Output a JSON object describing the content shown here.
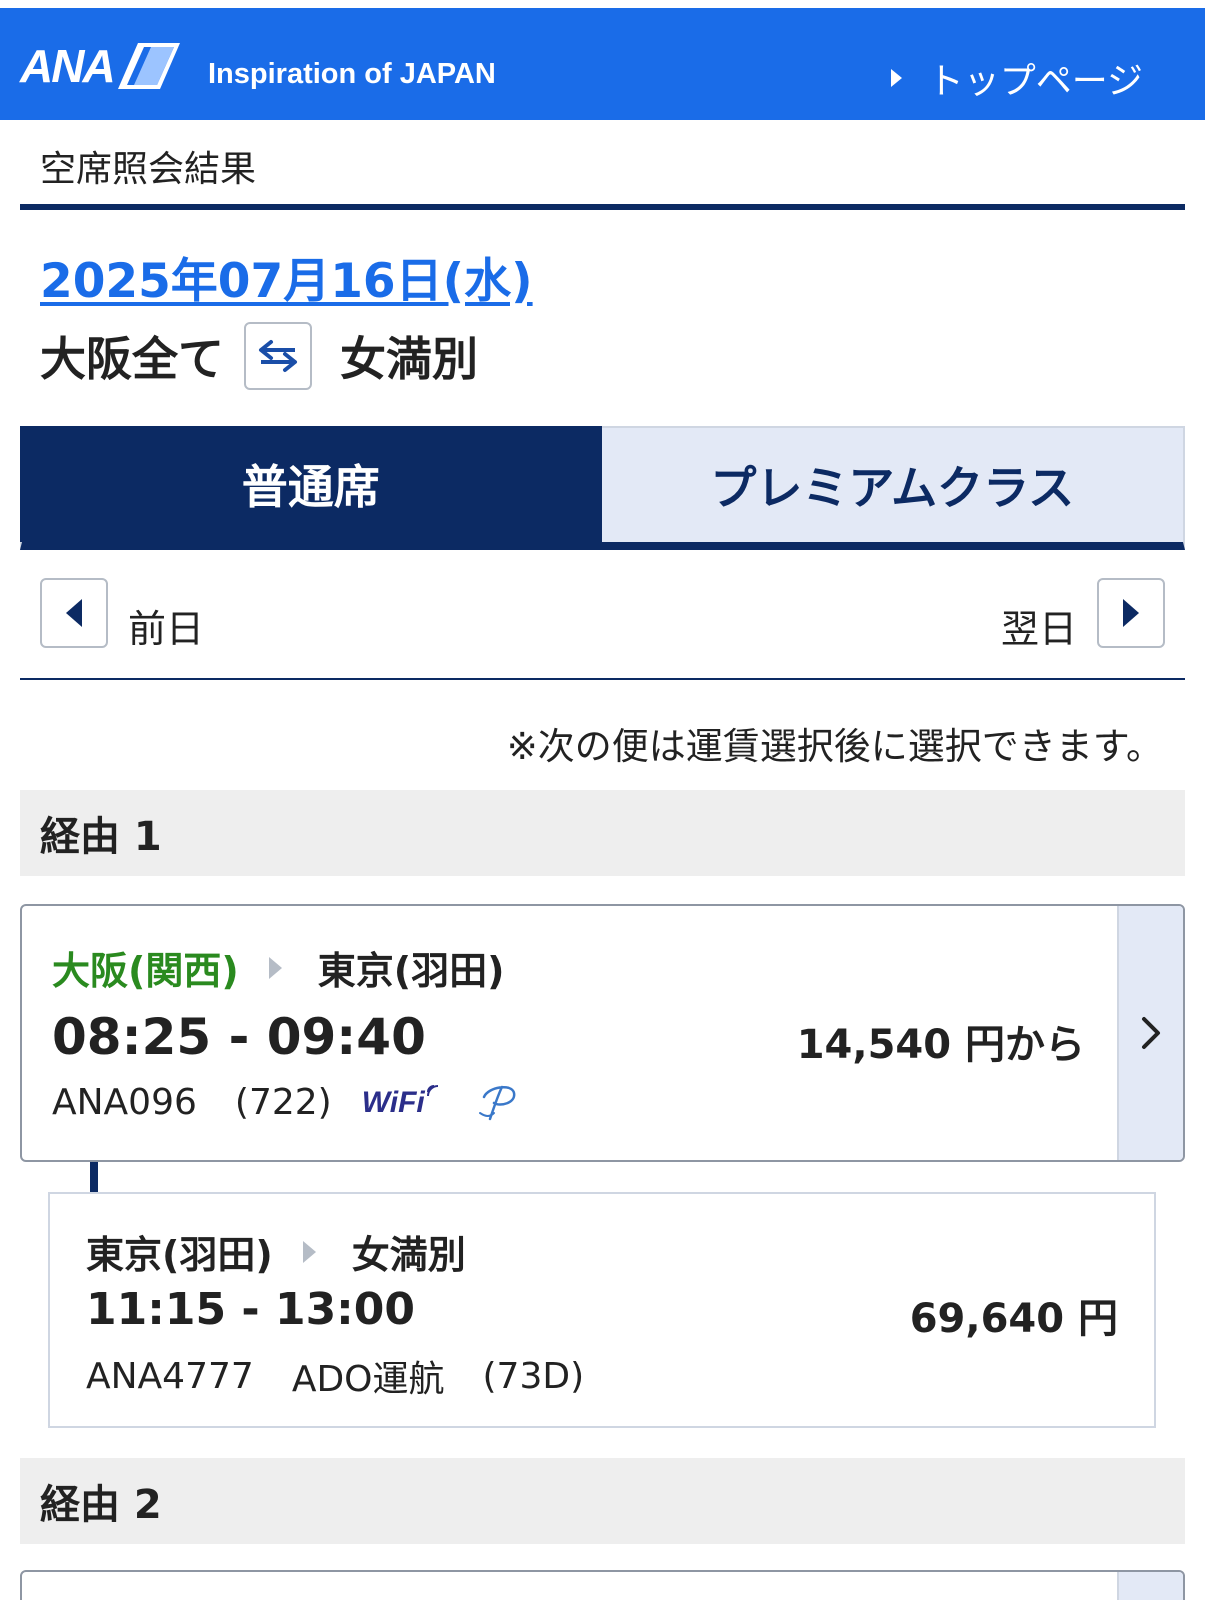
{
  "header": {
    "logo_text": "ANA",
    "tagline": "Inspiration of JAPAN",
    "top_link": "トップページ",
    "colors": {
      "brand_blue": "#1a6ce8",
      "navy": "#0c2a63"
    }
  },
  "page": {
    "title": "空席照会結果",
    "date": "2025年07月16日(水)",
    "origin": "大阪全て",
    "destination": "女満別",
    "swap_icon": "swap-arrows-icon"
  },
  "tabs": [
    {
      "label": "普通席",
      "active": true
    },
    {
      "label": "プレミアムクラス",
      "active": false
    }
  ],
  "day_nav": {
    "prev_label": "前日",
    "next_label": "翌日"
  },
  "notice": "※次の便は運賃選択後に選択できます。",
  "itineraries": [
    {
      "header": "経由 1",
      "segments": [
        {
          "from": "大阪(関西)",
          "to": "東京(羽田)",
          "time": "08:25 - 09:40",
          "price": "14,540 円から",
          "flight": "ANA096",
          "operator": "",
          "aircraft": "(722)",
          "wifi": "WiFi"
        },
        {
          "from": "東京(羽田)",
          "to": "女満別",
          "time": "11:15 - 13:00",
          "price": "69,640 円",
          "flight": "ANA4777",
          "operator": "ADO運航",
          "aircraft": "(73D)"
        }
      ]
    },
    {
      "header": "経由 2"
    }
  ]
}
